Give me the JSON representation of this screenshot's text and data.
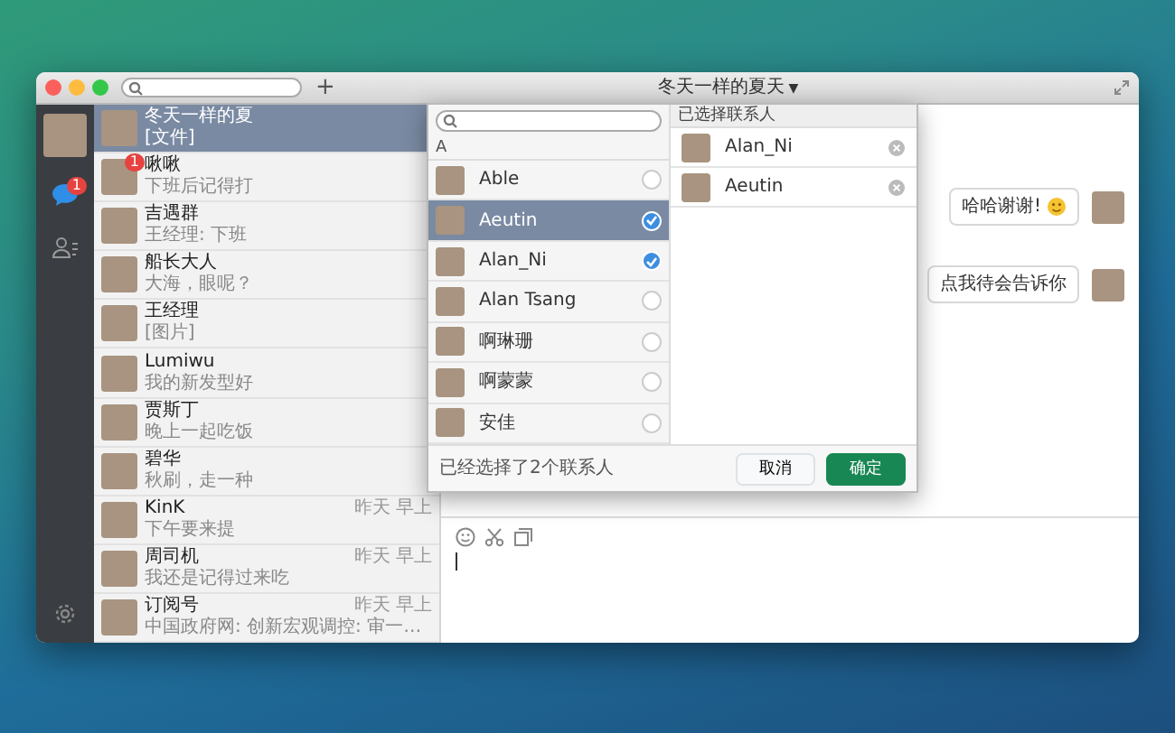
{
  "window": {
    "title": "冬天一样的夏天",
    "title_caret": "▼",
    "add_button": "+"
  },
  "sidebar": {
    "chat_badge": "1"
  },
  "chats": [
    {
      "name": "冬天一样的夏",
      "preview": "[文件]",
      "selected": true
    },
    {
      "name": "啾啾",
      "preview": "下班后记得打",
      "badge": "1",
      "selected": false
    },
    {
      "name": "吉遇群",
      "preview": "王经理: 下班",
      "selected": false
    },
    {
      "name": "船长大人",
      "preview": "大海，眼呢？",
      "selected": false
    },
    {
      "name": "王经理",
      "preview": "[图片]",
      "selected": false
    },
    {
      "name": "Lumiwu",
      "preview": "我的新发型好",
      "selected": false
    },
    {
      "name": "贾斯丁",
      "preview": "晚上一起吃饭",
      "selected": false
    },
    {
      "name": "碧华",
      "preview": "秋刷，走一种",
      "selected": false
    },
    {
      "name": "KinK",
      "preview": "下午要来提",
      "time": "昨天 早上",
      "selected": false
    },
    {
      "name": "周司机",
      "preview": "我还是记得过来吃",
      "time": "昨天 早上",
      "selected": false
    },
    {
      "name": "订阅号",
      "preview": "中国政府网: 创新宏观调控: 审一…",
      "time": "昨天 早上",
      "selected": false
    }
  ],
  "messages": [
    {
      "text": "哈哈谢谢!",
      "emoji": true
    },
    {
      "text": "点我待会告诉你",
      "emoji": false
    }
  ],
  "picker": {
    "section": "A",
    "contacts": [
      {
        "name": "Able",
        "selected": false,
        "checked": false
      },
      {
        "name": "Aeutin",
        "selected": true,
        "checked": true
      },
      {
        "name": "Alan_Ni",
        "selected": false,
        "checked": true
      },
      {
        "name": "Alan Tsang",
        "selected": false,
        "checked": false
      },
      {
        "name": "啊琳珊",
        "selected": false,
        "checked": false
      },
      {
        "name": "啊蒙蒙",
        "selected": false,
        "checked": false
      },
      {
        "name": "安佳",
        "selected": false,
        "checked": false
      }
    ],
    "selected_title": "已选择联系人",
    "selected_contacts": [
      {
        "name": "Alan_Ni"
      },
      {
        "name": "Aeutin"
      }
    ],
    "summary": "已经选择了2个联系人",
    "buttons": [
      {
        "label": "取消",
        "kind": "secondary"
      },
      {
        "label": "确定",
        "kind": "primary"
      }
    ]
  }
}
